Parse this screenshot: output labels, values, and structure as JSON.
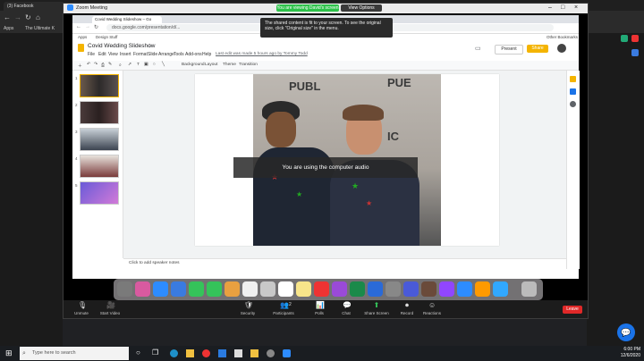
{
  "host": {
    "tabs": [
      "(3) Facebook",
      "Zoom Meeting"
    ],
    "bookmarks": [
      "Apps",
      "The Ultimate K"
    ],
    "clock_time": "6:00 PM",
    "clock_date": "12/6/2020"
  },
  "zoom": {
    "title": "Zoom Meeting",
    "share_banner": "You are viewing David's screen",
    "view_options": "View Options",
    "fit_notice": "The shared content is fit to your screen. To see the original size, click \"Original size\" in the menu.",
    "audio_toast": "You are using the computer audio",
    "controls": [
      {
        "icon": "🎙",
        "label": "Unmute"
      },
      {
        "icon": "🎥",
        "label": "Start Video"
      },
      {
        "icon": "🛡",
        "label": "Security"
      },
      {
        "icon": "👥",
        "label": "Participants"
      },
      {
        "icon": "📊",
        "label": "Polls"
      },
      {
        "icon": "💬",
        "label": "Chat"
      },
      {
        "icon": "⬆",
        "label": "Share Screen"
      },
      {
        "icon": "⏺",
        "label": "Record"
      },
      {
        "icon": "☺",
        "label": "Reactions"
      }
    ],
    "participants_count": "2",
    "leave": "Leave"
  },
  "chrome": {
    "tab_title": "Covid Wedding Slideshow – Go",
    "url": "docs.google.com/presentation/d/...",
    "bookmarks": [
      "Apps",
      "Design Stuff"
    ],
    "other_bookmarks": "Other Bookmarks"
  },
  "slides": {
    "doc_title": "Covid Wedding Slideshow",
    "menus": [
      "File",
      "Edit",
      "View",
      "Insert",
      "Format",
      "Slide",
      "Arrange",
      "Tools",
      "Add-ons",
      "Help"
    ],
    "last_edit": "Last edit was made 5 hours ago by Tommy Todd",
    "present": "Present",
    "share": "Share",
    "toolbar": [
      "Background",
      "Layout",
      "Theme",
      "Transition"
    ],
    "thumbnail_numbers": [
      "1",
      "2",
      "3",
      "4",
      "5"
    ],
    "notes_placeholder": "Click to add speaker notes",
    "photo_banner": [
      "PUBL",
      "PUE",
      "IC"
    ]
  },
  "taskbar": {
    "search_placeholder": "Type here to search"
  }
}
